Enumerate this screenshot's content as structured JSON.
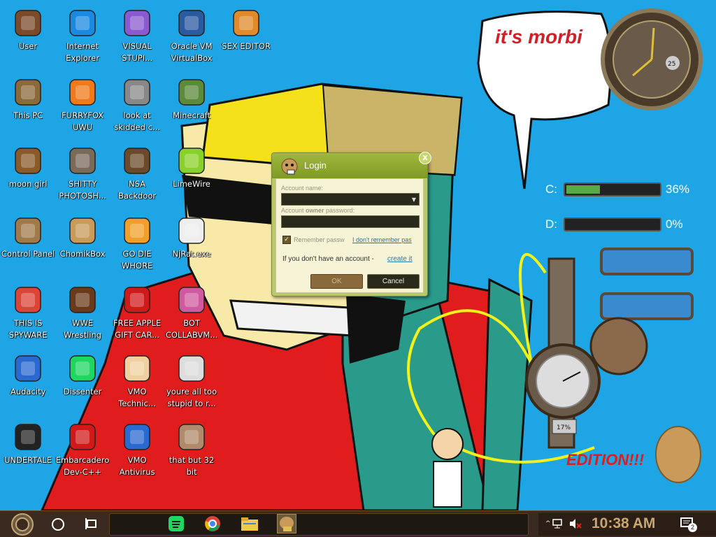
{
  "desktop": {
    "icons": [
      {
        "label": "User",
        "icon": "user-folder-icon"
      },
      {
        "label": "Internet Explorer",
        "icon": "edge-icon"
      },
      {
        "label": "VISUAL STUPI...",
        "icon": "visual-studio-icon"
      },
      {
        "label": "Oracle VM VirtualBox",
        "icon": "virtualbox-icon"
      },
      {
        "label": "SEX EDITOR",
        "icon": "hxd-icon"
      },
      {
        "label": "This PC",
        "icon": "this-pc-icon"
      },
      {
        "label": "FURRYFOX UWU",
        "icon": "firefox-icon"
      },
      {
        "label": "look at skidded c...",
        "icon": "stacked-windows-icon"
      },
      {
        "label": "Minecraft",
        "icon": "minecraft-icon"
      },
      {
        "label": "moon girl",
        "icon": "document-icon"
      },
      {
        "label": "SHITTY PHOTOSH...",
        "icon": "gimp-icon"
      },
      {
        "label": "NSA Backdoor",
        "icon": "backdoor-icon"
      },
      {
        "label": "LimeWire",
        "icon": "limewire-icon"
      },
      {
        "label": "Control Panel",
        "icon": "control-panel-icon"
      },
      {
        "label": "ChomikBox",
        "icon": "chomikbox-icon"
      },
      {
        "label": "GO DIE WHORE",
        "icon": "de-icon"
      },
      {
        "label": "NjRat.exe",
        "icon": "skull-icon"
      },
      {
        "label": "THIS IS SPYWARE",
        "icon": "chrome-icon"
      },
      {
        "label": "WWE Wrestling",
        "icon": "oven-icon"
      },
      {
        "label": "FREE APPLE GIFT CAR...",
        "icon": "apple-icon"
      },
      {
        "label": "BOT COLLABVM...",
        "icon": "monitor-icon"
      },
      {
        "label": "Audacity",
        "icon": "audacity-icon"
      },
      {
        "label": "Dissenter",
        "icon": "spotify-icon"
      },
      {
        "label": "VMO Technic...",
        "icon": "doctor-icon"
      },
      {
        "label": "youre all too stupid to r...",
        "icon": "portrait-icon"
      },
      {
        "label": "UNDERTALE",
        "icon": "unity-icon"
      },
      {
        "label": "Embarcadero Dev-C++",
        "icon": "devcpp-icon"
      },
      {
        "label": "VMO Antivirus",
        "icon": "shield-icon"
      },
      {
        "label": "that but 32 bit",
        "icon": "portrait2-icon"
      }
    ],
    "speech_text": "it's morbi"
  },
  "login_dialog": {
    "title": "Login",
    "account_name_label": "Account name:",
    "owner_label_pre": "Account ",
    "owner_label_bold": "owner",
    "owner_label_post": " password:",
    "remember_label": "Remember passw",
    "forgot_link": "I don't remember pas",
    "no_account_text": "If you don't have an account - ",
    "create_link": "create it",
    "ok_label": "OK",
    "cancel_label": "Cancel",
    "close_glyph": "x"
  },
  "gadgets": {
    "drives": [
      {
        "label": "C:",
        "percent_text": "36%",
        "fill": 0.36
      },
      {
        "label": "D:",
        "percent_text": "0%",
        "fill": 0.0
      }
    ],
    "clock_hours_marker": "25",
    "gauge_percent": "17%"
  },
  "taskbar": {
    "time": "10:38 AM",
    "notification_count": "2",
    "pinned": [
      "spotify-icon",
      "chrome-icon",
      "file-explorer-icon",
      "chomikbox-icon"
    ]
  },
  "colors": {
    "desktop_bg": "#1ea5e6",
    "dialog_accent": "#8ea830",
    "taskbar_bg": "#3a2a20",
    "clock_text": "#c9a66b"
  }
}
